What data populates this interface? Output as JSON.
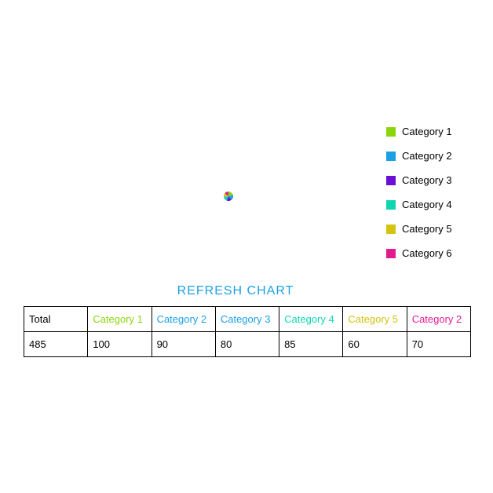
{
  "chart_data": {
    "type": "pie",
    "title": "",
    "series": [
      {
        "name": "Category 1",
        "value": 100,
        "color": "#8bd50f"
      },
      {
        "name": "Category 2",
        "value": 90,
        "color": "#1ca0e3"
      },
      {
        "name": "Category 3",
        "value": 80,
        "color": "#6b0fd5"
      },
      {
        "name": "Category 4",
        "value": 85,
        "color": "#0fd5b1"
      },
      {
        "name": "Category 5",
        "value": 60,
        "color": "#d5c30f"
      },
      {
        "name": "Category 6",
        "value": 70,
        "color": "#e31c8e"
      }
    ]
  },
  "legend": {
    "items": [
      {
        "label": "Category 1",
        "color": "#8bd50f"
      },
      {
        "label": "Category 2",
        "color": "#1ca0e3"
      },
      {
        "label": "Category 3",
        "color": "#6b0fd5"
      },
      {
        "label": "Category 4",
        "color": "#0fd5b1"
      },
      {
        "label": "Category 5",
        "color": "#d5c30f"
      },
      {
        "label": "Category 6",
        "color": "#e31c8e"
      }
    ]
  },
  "refresh_label": "REFRESH CHART",
  "table": {
    "headers": [
      {
        "label": "Total",
        "color": "#000000"
      },
      {
        "label": "Category 1",
        "color": "#8bd50f"
      },
      {
        "label": "Category 2",
        "color": "#1ca0e3"
      },
      {
        "label": "Category 3",
        "color": "#1ca0e3"
      },
      {
        "label": "Category 4",
        "color": "#0fd5b1"
      },
      {
        "label": "Category 5",
        "color": "#d5c30f"
      },
      {
        "label": "Category 2",
        "color": "#e31c8e"
      }
    ],
    "row": [
      "485",
      "100",
      "90",
      "80",
      "85",
      "60",
      "70"
    ]
  }
}
